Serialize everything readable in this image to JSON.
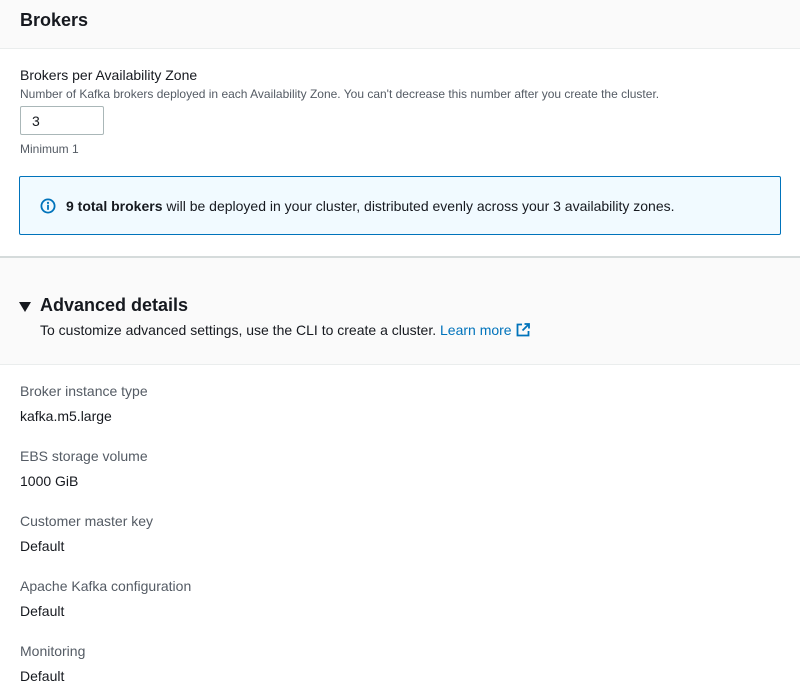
{
  "brokers": {
    "title": "Brokers",
    "per_az_label": "Brokers per Availability Zone",
    "per_az_description": "Number of Kafka brokers deployed in each Availability Zone. You can't decrease this number after you create the cluster.",
    "per_az_value": "3",
    "per_az_hint": "Minimum 1",
    "info": {
      "icon": "info-icon",
      "bold_text": "9 total brokers",
      "rest_text": " will be deployed in your cluster, distributed evenly across your 3 availability zones."
    }
  },
  "advanced": {
    "title": "Advanced details",
    "expanded": true,
    "description": "To customize advanced settings, use the CLI to create a cluster.",
    "learn_more_label": "Learn more",
    "details": [
      {
        "label": "Broker instance type",
        "value": "kafka.m5.large"
      },
      {
        "label": "EBS storage volume",
        "value": "1000 GiB"
      },
      {
        "label": "Customer master key",
        "value": "Default"
      },
      {
        "label": "Apache Kafka configuration",
        "value": "Default"
      },
      {
        "label": "Monitoring",
        "value": "Default"
      }
    ]
  },
  "colors": {
    "link": "#0073bb",
    "info_border": "#0073bb",
    "info_background": "#f1faff",
    "header_background": "#fafafa"
  }
}
